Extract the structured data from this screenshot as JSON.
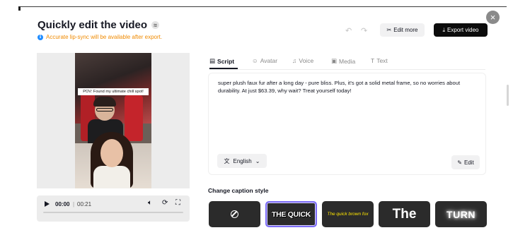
{
  "header": {
    "title": "Quickly edit the video",
    "notice": "Accurate lip-sync will be available after export.",
    "edit_more_label": "Edit more",
    "export_label": "Export video"
  },
  "video": {
    "caption_overlay": "POV: Found my ultimate chill spot!"
  },
  "player": {
    "current_time": "00:00",
    "separator": "|",
    "total_time": "00:21",
    "progress": 0
  },
  "tabs": [
    {
      "label": "Script",
      "active": true
    },
    {
      "label": "Avatar",
      "active": false
    },
    {
      "label": "Voice",
      "active": false
    },
    {
      "label": "Media",
      "active": false
    },
    {
      "label": "Text",
      "active": false
    }
  ],
  "script": {
    "text": "super plush faux fur after a long day - pure bliss. Plus, it's got a solid metal frame, so no worries about durability. At just $63.39, why wait? Treat yourself today!",
    "language": "English",
    "edit_label": "Edit"
  },
  "caption_style": {
    "heading": "Change caption style",
    "options": [
      {
        "kind": "none",
        "label": ""
      },
      {
        "kind": "bold",
        "label": "THE QUICK",
        "selected": true
      },
      {
        "kind": "yellow-italic",
        "label": "The quick brown fox"
      },
      {
        "kind": "large",
        "label": "The"
      },
      {
        "kind": "glow",
        "label": "TURN"
      }
    ]
  },
  "colors": {
    "accent_selected": "#7b6cf6",
    "notice": "#f08a00",
    "info": "#1f8cff"
  }
}
